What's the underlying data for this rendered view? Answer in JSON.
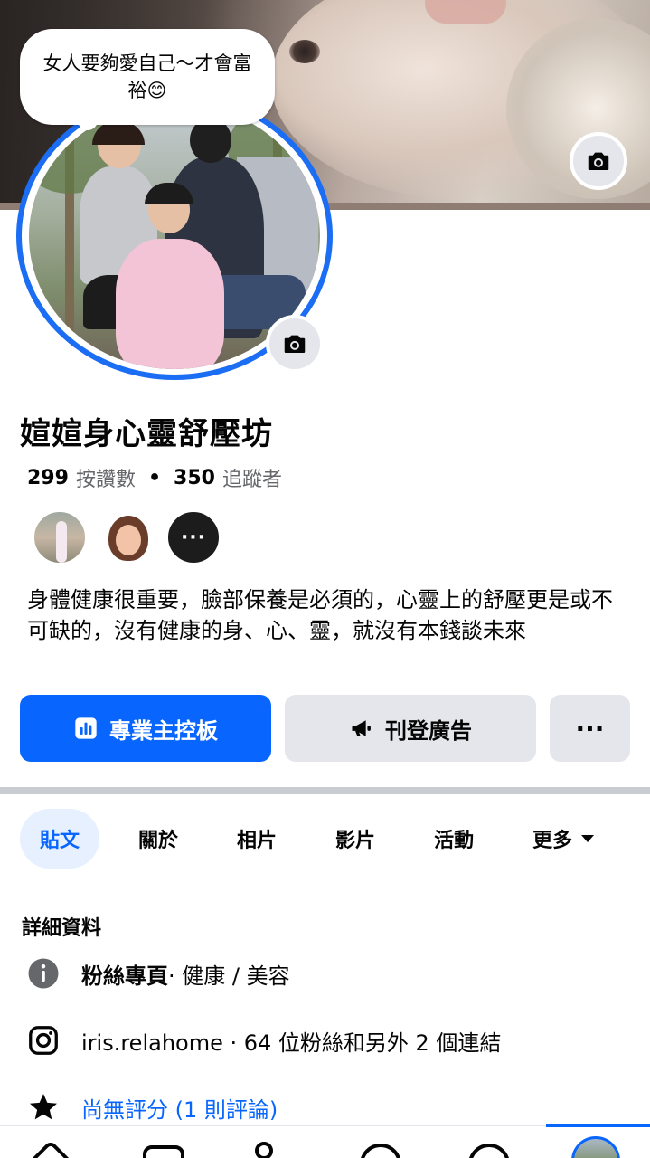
{
  "cover": {
    "camera_icon": "camera-icon"
  },
  "profile": {
    "status_bubble": "女人要夠愛自己～才會富裕😊",
    "name": "媗媗身心靈舒壓坊",
    "likes_count": "299",
    "likes_label": "按讚數",
    "separator": "•",
    "followers_count": "350",
    "followers_label": "追蹤者",
    "more_friends": "···",
    "bio": "身體健康很重要，臉部保養是必須的，心靈上的舒壓更是或不可缺的，沒有健康的身、心、靈，就沒有本錢談未來"
  },
  "actions": {
    "dashboard_label": "專業主控板",
    "advertise_label": "刊登廣告",
    "more_label": "···"
  },
  "tabs": [
    {
      "label": "貼文",
      "active": true
    },
    {
      "label": "關於",
      "active": false
    },
    {
      "label": "相片",
      "active": false
    },
    {
      "label": "影片",
      "active": false
    },
    {
      "label": "活動",
      "active": false
    },
    {
      "label": "更多",
      "active": false
    }
  ],
  "details": {
    "title": "詳細資料",
    "page_type_bold": "粉絲專頁",
    "page_type_rest": " · 健康 / 美容",
    "instagram": "iris.relahome · 64 位粉絲和另外 2 個連結",
    "rating": "尚無評分 (1 則評論)"
  },
  "colors": {
    "accent": "#0866ff",
    "button_gray": "#e4e6eb",
    "ring": "#1b6ef3"
  }
}
